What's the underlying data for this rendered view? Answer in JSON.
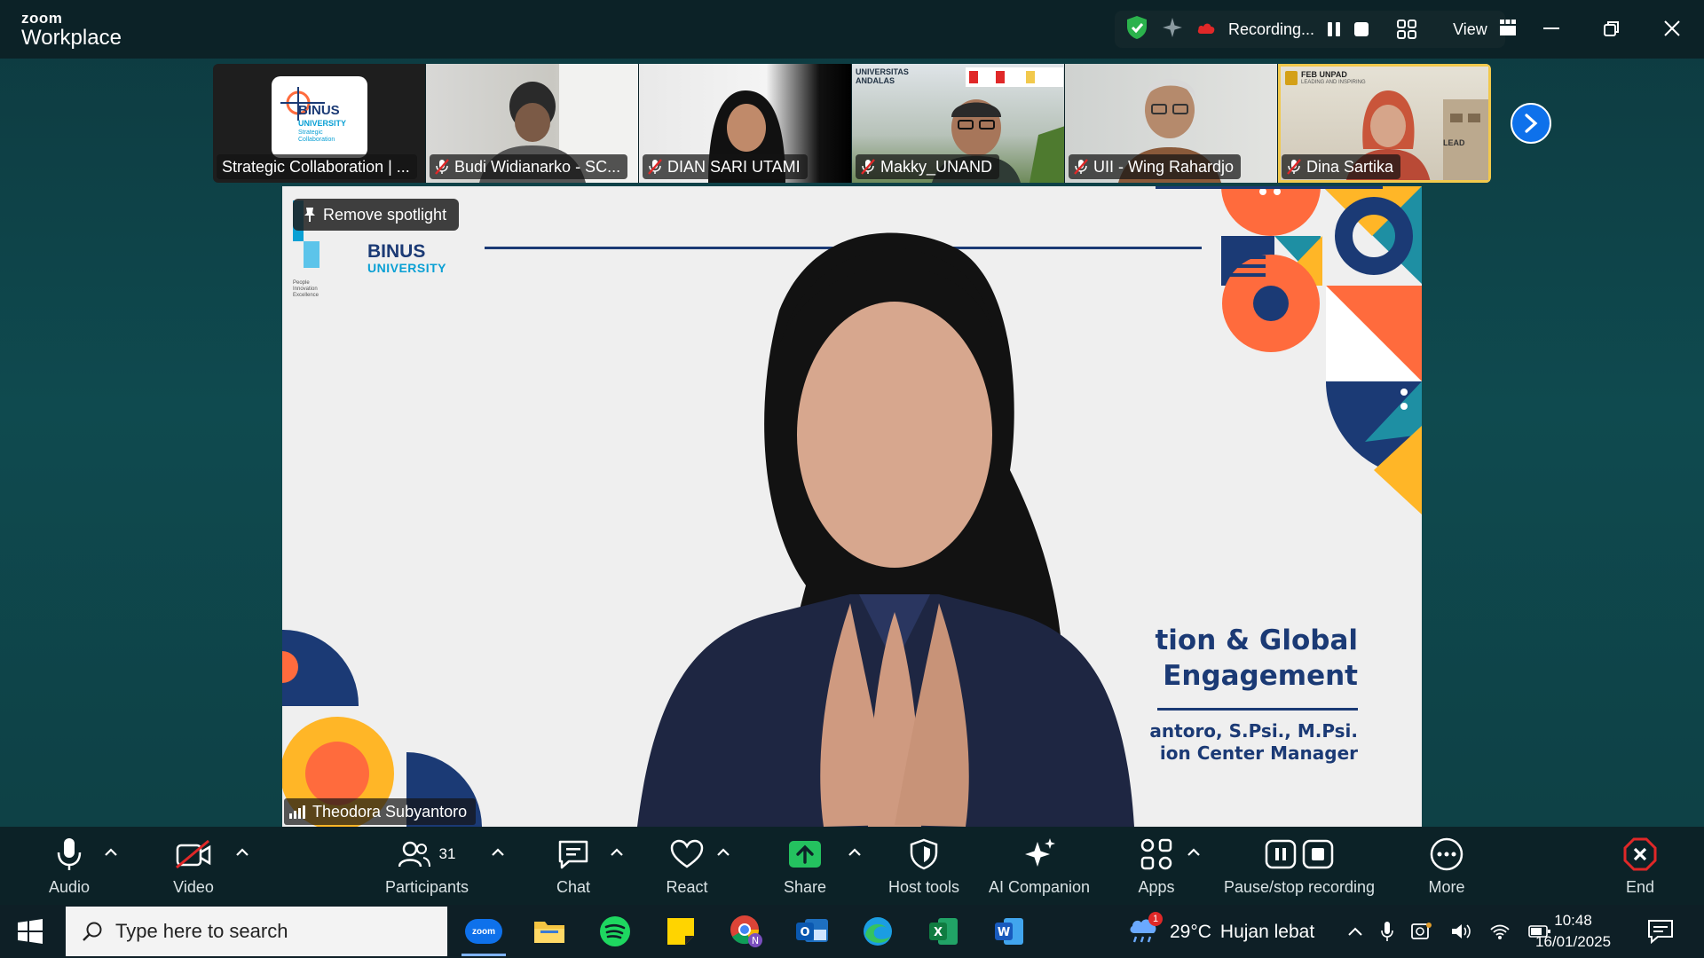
{
  "app": {
    "brand_top": "zoom",
    "brand_bottom": "Workplace"
  },
  "recording": {
    "status": "Recording...",
    "view_label": "View"
  },
  "thumbnails": [
    {
      "name": "Strategic Collaboration | ...",
      "muted": false,
      "logo_text": "BINUS",
      "logo_sub": "UNIVERSITY",
      "logo_caption": "Strategic Collaboration"
    },
    {
      "name": "Budi Widianarko - SC...",
      "muted": true
    },
    {
      "name": "DIAN SARI UTAMI",
      "muted": true
    },
    {
      "name": "Makky_UNAND",
      "muted": true,
      "banner": "UNIVERSITAS ANDALAS"
    },
    {
      "name": "UII - Wing Rahardjo",
      "muted": true
    },
    {
      "name": "Dina Sartika",
      "muted": true,
      "banner": "FEB UNPAD",
      "banner_sub": "LEADING AND INSPIRING",
      "sign": "LEAD",
      "active": true
    }
  ],
  "spotlight": {
    "remove_label": "Remove spotlight",
    "speaker_name": "Theodora Subyantoro",
    "slide": {
      "logo_main": "BINUS",
      "logo_sub": "UNIVERSITY",
      "logo_tagline": [
        "People",
        "Innovation",
        "Excellence"
      ],
      "title_line1": "tion & Global",
      "title_line2": "Engagement",
      "presenter_line1": "antoro, S.Psi., M.Psi.",
      "presenter_line2": "ion Center Manager"
    }
  },
  "toolbar": {
    "audio": "Audio",
    "video": "Video",
    "participants": "Participants",
    "participants_count": "31",
    "chat": "Chat",
    "react": "React",
    "share": "Share",
    "host_tools": "Host tools",
    "ai_companion": "AI Companion",
    "apps": "Apps",
    "pause_stop": "Pause/stop recording",
    "more": "More",
    "end": "End"
  },
  "taskbar": {
    "search_placeholder": "Type here to search",
    "zoom_app": "zoom",
    "weather_temp": "29°C",
    "weather_desc": "Hujan lebat",
    "weather_badge": "1",
    "time": "10:48",
    "date": "16/01/2025"
  },
  "colors": {
    "accent_blue": "#0e71eb",
    "share_green": "#24c15f",
    "end_red": "#e02828",
    "active_outline": "#f2c94c",
    "slide_navy": "#1b3a75",
    "slide_orange": "#ff6b3d",
    "slide_yellow": "#ffb627",
    "slide_teal": "#1e8fa3"
  }
}
